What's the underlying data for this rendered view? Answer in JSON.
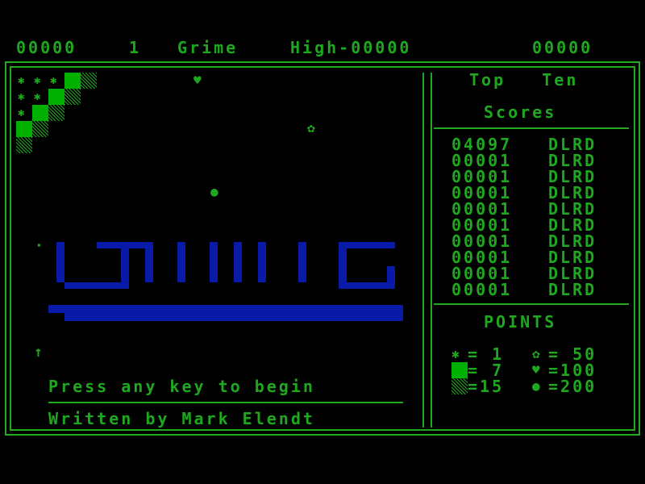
{
  "header": {
    "score": "00000",
    "player": "1",
    "title": "Grime",
    "high": "High-00000",
    "score2": "00000"
  },
  "sidebar": {
    "title_line1": "Top   Ten",
    "title_line2": "Scores",
    "scores": [
      {
        "score": "04097",
        "name": "DLRD"
      },
      {
        "score": "00001",
        "name": "DLRD"
      },
      {
        "score": "00001",
        "name": "DLRD"
      },
      {
        "score": "00001",
        "name": "DLRD"
      },
      {
        "score": "00001",
        "name": "DLRD"
      },
      {
        "score": "00001",
        "name": "DLRD"
      },
      {
        "score": "00001",
        "name": "DLRD"
      },
      {
        "score": "00001",
        "name": "DLRD"
      },
      {
        "score": "00001",
        "name": "DLRD"
      },
      {
        "score": "00001",
        "name": "DLRD"
      }
    ],
    "points_title": "POINTS",
    "points": {
      "row1_left": "= 1",
      "row1_right": "= 50",
      "row2_left": "= 7",
      "row2_right": "=100",
      "row3_left": "=15",
      "row3_right": "=200"
    }
  },
  "playfield": {
    "prompt": "Press any key to begin",
    "credit": "Written by Mark Elendt"
  },
  "icons": {
    "cross": "cross-icon",
    "flower": "flower-icon",
    "heart": "heart-icon",
    "blob": "blob-icon",
    "arrow": "up-arrow-icon"
  },
  "colors": {
    "green": "#1fa81f",
    "solid_green": "#00b000",
    "blue": "#0a1aa8",
    "background": "#000000"
  }
}
